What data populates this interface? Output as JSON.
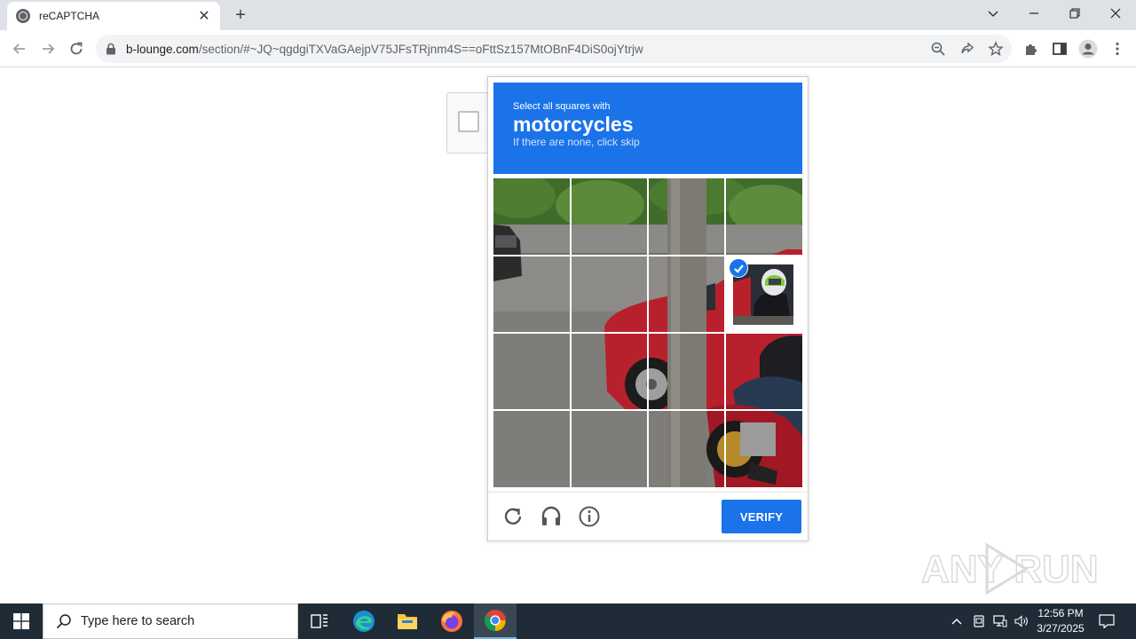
{
  "browser": {
    "tab_title": "reCAPTCHA",
    "tab_close": "✕",
    "new_tab": "+",
    "url_host": "b-lounge.com",
    "url_path": "/section/#~JQ~qgdgiTXVaGAejpV75JFsTRjnm4S==oFttSz157MtOBnF4DiS0ojYtrjw"
  },
  "captcha": {
    "prompt_line1": "Select all squares with",
    "prompt_target": "motorcycles",
    "prompt_hint": "If there are none, click skip",
    "grid_rows": 4,
    "grid_cols": 4,
    "selected_tiles": [
      {
        "row": 2,
        "col": 4
      }
    ],
    "verify_label": "VERIFY",
    "footer_icons": [
      "reload-icon",
      "audio-challenge-icon",
      "info-icon"
    ],
    "colors": {
      "header": "#1a73e8",
      "verify": "#1a73e8"
    }
  },
  "watermark": {
    "text": "ANY RUN"
  },
  "taskbar": {
    "search_placeholder": "Type here to search",
    "time": "12:56 PM",
    "date": "3/27/2025",
    "apps": [
      "task-view-icon",
      "edge-icon",
      "file-explorer-icon",
      "firefox-icon",
      "chrome-icon"
    ]
  }
}
